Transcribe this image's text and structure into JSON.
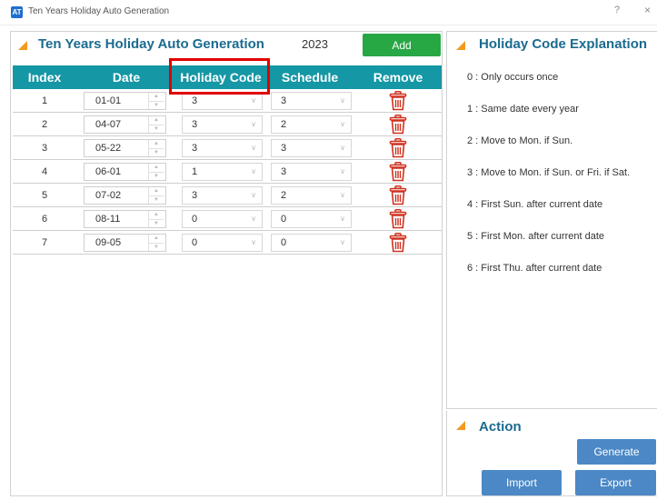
{
  "window": {
    "icon_text": "AT",
    "title": "Ten Years Holiday Auto Generation",
    "help_label": "?",
    "close_label": "×"
  },
  "generation": {
    "title": "Ten Years Holiday Auto Generation",
    "year": "2023",
    "add_label": "Add",
    "columns": {
      "index": "Index",
      "date": "Date",
      "holiday_code": "Holiday Code",
      "schedule": "Schedule",
      "remove": "Remove"
    },
    "rows": [
      {
        "index": "1",
        "date": "01-01",
        "holiday_code": "3",
        "schedule": "3"
      },
      {
        "index": "2",
        "date": "04-07",
        "holiday_code": "3",
        "schedule": "2"
      },
      {
        "index": "3",
        "date": "05-22",
        "holiday_code": "3",
        "schedule": "3"
      },
      {
        "index": "4",
        "date": "06-01",
        "holiday_code": "1",
        "schedule": "3"
      },
      {
        "index": "5",
        "date": "07-02",
        "holiday_code": "3",
        "schedule": "2"
      },
      {
        "index": "6",
        "date": "08-11",
        "holiday_code": "0",
        "schedule": "0"
      },
      {
        "index": "7",
        "date": "09-05",
        "holiday_code": "0",
        "schedule": "0"
      }
    ]
  },
  "explanation": {
    "title": "Holiday Code Explanation",
    "items": [
      "0 : Only occurs once",
      "1 : Same date every year",
      "2 : Move to Mon. if Sun.",
      "3 : Move to Mon. if Sun. or Fri. if Sat.",
      "4 : First Sun. after current date",
      "5 : First Mon. after current date",
      "6 : First Thu. after current date"
    ]
  },
  "action": {
    "title": "Action",
    "generate_label": "Generate",
    "import_label": "Import",
    "export_label": "Export"
  },
  "colors": {
    "header_bg": "#1597a5",
    "title_text": "#1a6b8f",
    "accent_marker": "#f39a1e",
    "add_button": "#28a745",
    "action_button": "#4b88c5",
    "remove_icon": "#d0311f",
    "highlight": "#e00000"
  },
  "icons": {
    "app": "app-icon",
    "remove": "trash-icon",
    "section": "orange-triangle-icon"
  }
}
